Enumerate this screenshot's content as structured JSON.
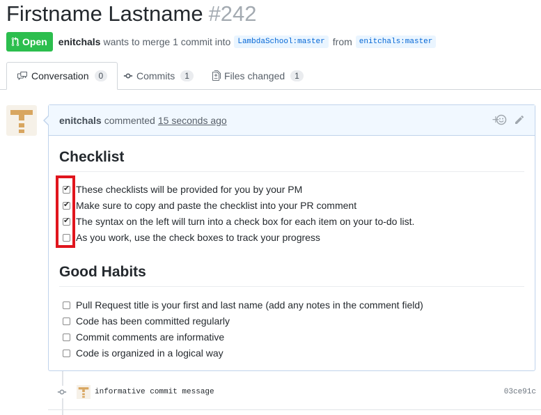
{
  "pr": {
    "title": "Firstname Lastname",
    "number": "#242",
    "state": "Open",
    "author": "enitchals",
    "merge_text": "wants to merge 1 commit into",
    "base_branch": "LambdaSchool:master",
    "from_text": "from",
    "head_branch": "enitchals:master"
  },
  "tabs": [
    {
      "label": "Conversation",
      "count": "0",
      "icon": "conversation-icon"
    },
    {
      "label": "Commits",
      "count": "1",
      "icon": "commit-icon"
    },
    {
      "label": "Files changed",
      "count": "1",
      "icon": "file-diff-icon"
    }
  ],
  "comment": {
    "author": "enitchals",
    "action": "commented",
    "time": "15 seconds ago"
  },
  "checklist": {
    "heading": "Checklist",
    "items": [
      {
        "text": "These checklists will be provided for you by your PM",
        "checked": true
      },
      {
        "text": "Make sure to copy and paste the checklist into your PR comment",
        "checked": true
      },
      {
        "text": "The syntax on the left will turn into a check box for each item on your to-do list.",
        "checked": true
      },
      {
        "text": "As you work, use the check boxes to track your progress",
        "checked": false
      }
    ]
  },
  "habits": {
    "heading": "Good Habits",
    "items": [
      {
        "text": "Pull Request title is your first and last name (add any notes in the comment field)",
        "checked": false
      },
      {
        "text": "Code has been committed regularly",
        "checked": false
      },
      {
        "text": "Commit comments are informative",
        "checked": false
      },
      {
        "text": "Code is organized in a logical way",
        "checked": false
      }
    ]
  },
  "commit": {
    "message": "informative commit message",
    "sha": "03ce91c"
  },
  "colors": {
    "open_green": "#2cbe4e",
    "highlight_red": "#e0151d",
    "link_blue": "#0366d6"
  }
}
